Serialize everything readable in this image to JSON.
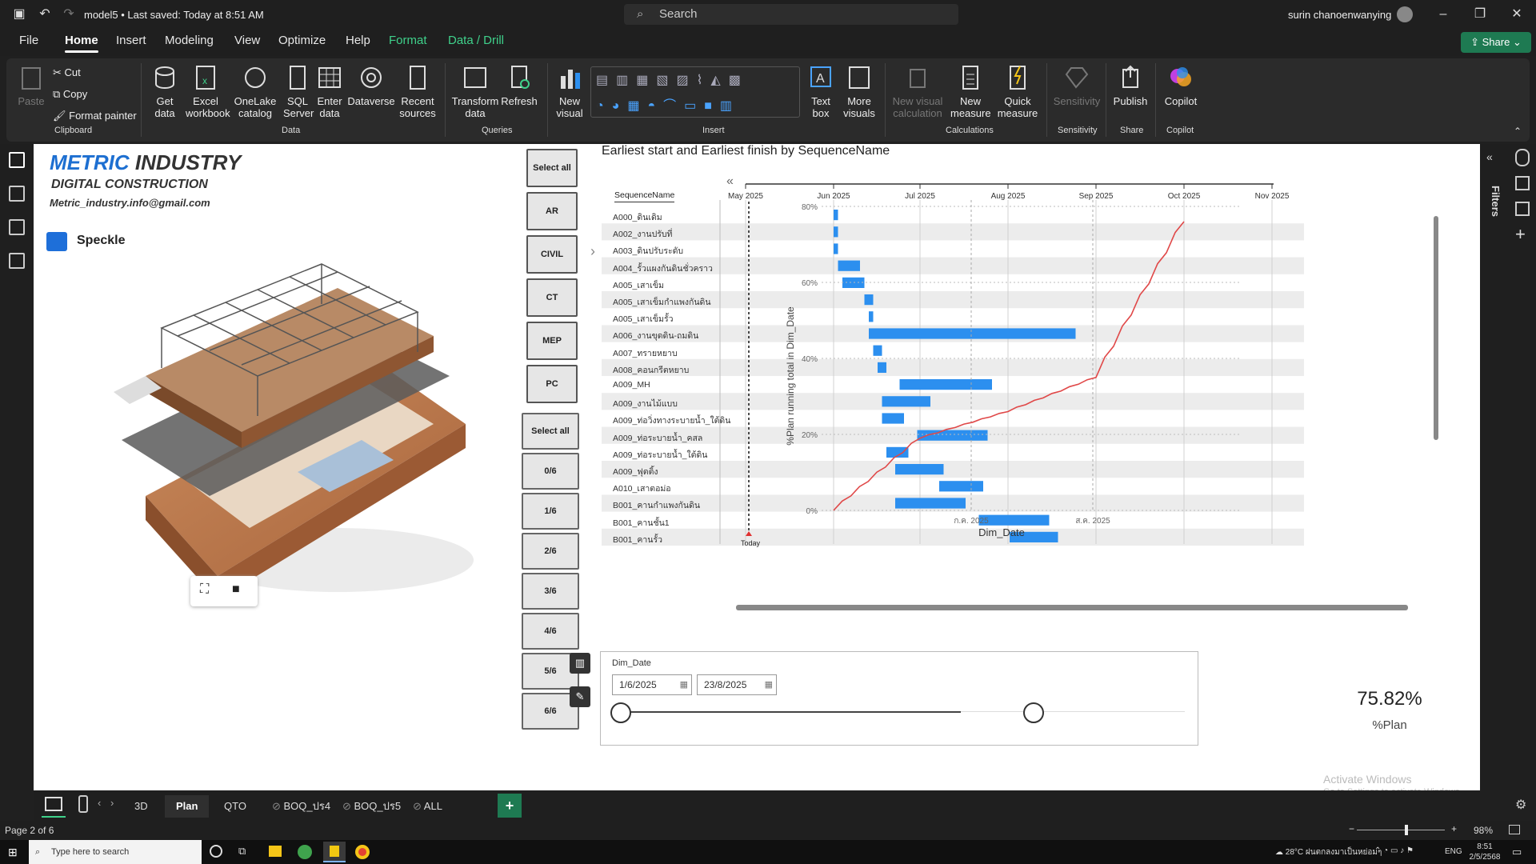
{
  "titlebar": {
    "file_status": "model5 • Last saved: Today at 8:51 AM",
    "search_placeholder": "Search",
    "user": "surin chanoenwanying"
  },
  "menu": {
    "items": [
      "File",
      "Home",
      "Insert",
      "Modeling",
      "View",
      "Optimize",
      "Help",
      "Format",
      "Data / Drill"
    ],
    "active": "Home",
    "share": "Share"
  },
  "ribbon": {
    "clipboard": {
      "paste": "Paste",
      "cut": "Cut",
      "copy": "Copy",
      "format_painter": "Format painter",
      "group": "Clipboard"
    },
    "data": {
      "get_data": "Get data",
      "excel": "Excel workbook",
      "onelake": "OneLake catalog",
      "sql": "SQL Server",
      "enter": "Enter data",
      "dataverse": "Dataverse",
      "recent": "Recent sources",
      "group": "Data"
    },
    "queries": {
      "transform": "Transform data",
      "refresh": "Refresh",
      "group": "Queries"
    },
    "insert": {
      "new_visual": "New visual",
      "text_box": "Text box",
      "more_visuals": "More visuals",
      "group": "Insert"
    },
    "calculations": {
      "new_visual_calc": "New visual calculation",
      "new_measure": "New measure",
      "quick_measure": "Quick measure",
      "group": "Calculations"
    },
    "sensitivity": {
      "label": "Sensitivity",
      "group": "Sensitivity"
    },
    "share": {
      "publish": "Publish",
      "group": "Share"
    },
    "copilot": {
      "label": "Copilot",
      "group": "Copilot"
    }
  },
  "report": {
    "company": "METRIC INDUSTRY",
    "company_a": "METRIC",
    "company_b": "INDUSTRY",
    "subtitle": "DIGITAL  CONSTRUCTION",
    "email": "Metric_industry.info@gmail.com",
    "speckle": "Speckle",
    "slicer1": [
      "Select all",
      "AR",
      "CIVIL",
      "CT",
      "MEP",
      "PC"
    ],
    "slicer2": [
      "Select all",
      "0/6",
      "1/6",
      "2/6",
      "3/6",
      "4/6",
      "5/6",
      "6/6"
    ],
    "gantt_title": "Earliest start and Earliest finish by SequenceName",
    "col_header": "SequenceName",
    "rows": [
      "A000_ดินเดิม",
      "A002_งานปรับที่",
      "A003_ดินปรับระดับ",
      "A004_รั้วแผงกันดินชั่วคราว",
      "A005_เสาเข็ม",
      "A005_เสาเข็มกำแพงกันดิน",
      "A005_เสาเข็มรั้ว",
      "A006_งานขุดดิน-ถมดิน",
      "A007_ทรายหยาบ",
      "A008_คอนกรีตหยาบ",
      "A009_MH",
      "A009_งานไม้แบบ",
      "A009_ท่อวิ่งทางระบายน้ำ_ใต้ดิน",
      "A009_ท่อระบายน้ำ_คสล",
      "A009_ท่อระบายน้ำ_ใต้ดิน",
      "A009_ฟุตติ้ง",
      "A010_เสาตอม่อ",
      "B001_คานกำแพงกันดิน",
      "B001_คานชั้น1",
      "B001_คานรั้ว"
    ],
    "months": [
      "May 2025",
      "Jun 2025",
      "Jul 2025",
      "Aug 2025",
      "Sep 2025",
      "Oct 2025",
      "Nov 2025"
    ],
    "today": "Today",
    "y_axis_label": "%Plan running total in Dim_Date",
    "y_ticks": [
      "80%",
      "60%",
      "40%",
      "20%",
      "0%"
    ],
    "x_sub_ticks": [
      "ก.ค. 2025",
      "ส.ค. 2025"
    ],
    "x_axis_label": "Dim_Date",
    "date_slicer": {
      "title": "Dim_Date",
      "start": "1/6/2025",
      "end": "23/8/2025"
    },
    "kpi": {
      "value": "75.82%",
      "label": "%Plan"
    }
  },
  "chart_data": {
    "type": "line",
    "title": "",
    "ylabel": "%Plan running total in Dim_Date",
    "xlabel": "Dim_Date",
    "ylim": [
      0,
      80
    ],
    "x": [
      "Jun 2025",
      "Jul 2025",
      "Aug 2025",
      "Sep 2025",
      "Oct 2025"
    ],
    "series": [
      {
        "name": "%Plan running total in Dim_Date",
        "values": [
          0,
          19,
          26,
          35,
          76
        ]
      }
    ]
  },
  "gantt_bars": [
    {
      "start": 0.0,
      "end": 0.01
    },
    {
      "start": 0.0,
      "end": 0.01
    },
    {
      "start": 0.0,
      "end": 0.01
    },
    {
      "start": 0.01,
      "end": 0.06
    },
    {
      "start": 0.02,
      "end": 0.07
    },
    {
      "start": 0.07,
      "end": 0.09
    },
    {
      "start": 0.08,
      "end": 0.09
    },
    {
      "start": 0.08,
      "end": 0.55
    },
    {
      "start": 0.09,
      "end": 0.11
    },
    {
      "start": 0.1,
      "end": 0.12
    },
    {
      "start": 0.15,
      "end": 0.36
    },
    {
      "start": 0.11,
      "end": 0.22
    },
    {
      "start": 0.11,
      "end": 0.16
    },
    {
      "start": 0.19,
      "end": 0.35
    },
    {
      "start": 0.12,
      "end": 0.17
    },
    {
      "start": 0.14,
      "end": 0.25
    },
    {
      "start": 0.24,
      "end": 0.34
    },
    {
      "start": 0.14,
      "end": 0.3
    },
    {
      "start": 0.33,
      "end": 0.49
    },
    {
      "start": 0.4,
      "end": 0.51
    }
  ],
  "tabs": [
    "3D",
    "Plan",
    "QTO",
    "BOQ_ปร4",
    "BOQ_ปร5",
    "ALL"
  ],
  "active_tab": "Plan",
  "status": {
    "page": "Page 2 of 6",
    "zoom": "98%",
    "watermark1": "Activate Windows",
    "watermark2": "Go to Settings to activate Windows."
  },
  "taskbar": {
    "search": "Type here to search",
    "weather": "28°C ฝนตกลงมาเป็นหย่อมๆ",
    "lang": "ENG",
    "time": "8:51",
    "date": "2/5/2568"
  }
}
